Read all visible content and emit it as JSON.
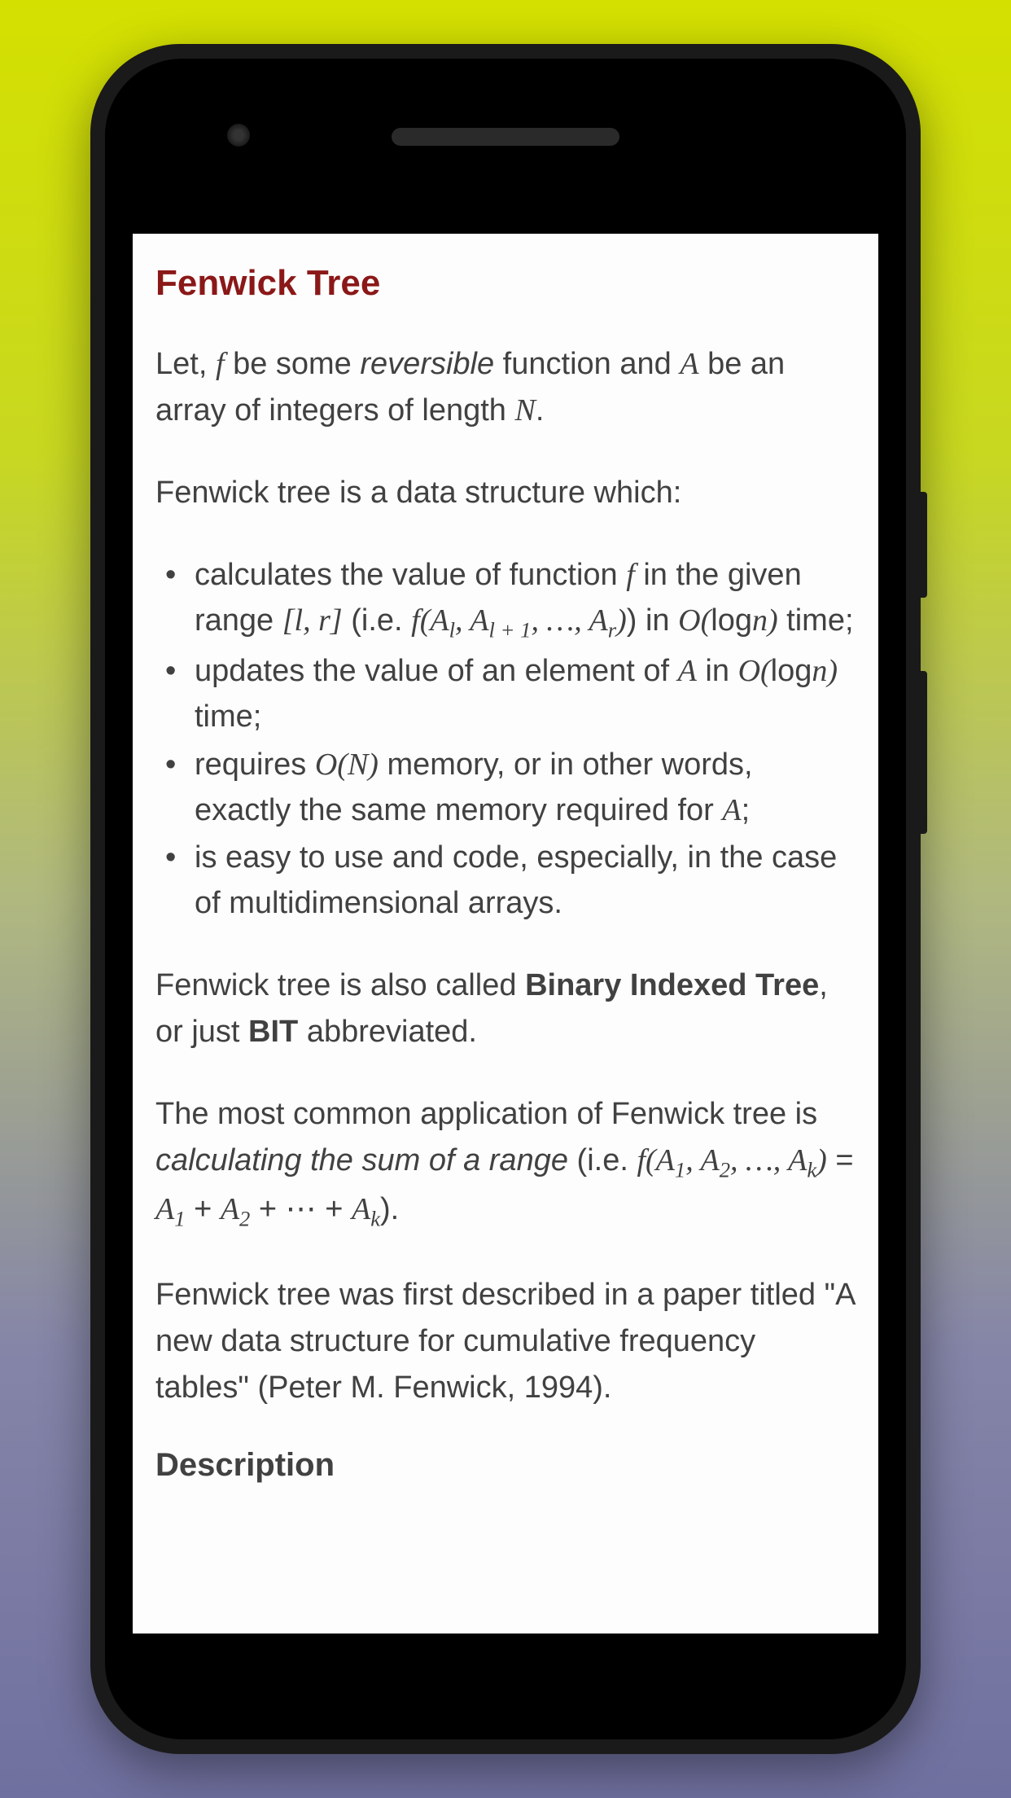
{
  "article": {
    "title": "Fenwick Tree",
    "intro_p1": "Let, ",
    "intro_f": "f",
    "intro_p2": " be some ",
    "intro_rev": "reversible",
    "intro_p3": " function and ",
    "intro_A": "A",
    "intro_p4": " be an array of integers of length ",
    "intro_N": "N",
    "intro_p5": ".",
    "p2": "Fenwick tree is a data structure which:",
    "bullets": {
      "b1_a": "calculates the value of function ",
      "b1_f": "f",
      "b1_b": " in the given range ",
      "b1_range": "[l, r]",
      "b1_c": " (i.e. ",
      "b1_func": "f(A",
      "b1_sub1": "l",
      "b1_comma1": ", A",
      "b1_sub2": "l + 1",
      "b1_comma2": ", …, A",
      "b1_sub3": "r",
      "b1_close": ")",
      "b1_d": ") in ",
      "b1_O": "O(",
      "b1_log": "log",
      "b1_n": "n",
      "b1_Oclose": ")",
      "b1_e": " time;",
      "b2_a": "updates the value of an element of ",
      "b2_A": "A",
      "b2_b": " in ",
      "b2_O": "O(",
      "b2_log": "log",
      "b2_n": "n",
      "b2_Oclose": ")",
      "b2_c": " time;",
      "b3_a": "requires ",
      "b3_O": "O(N)",
      "b3_b": " memory, or in other words, exactly the same memory required for ",
      "b3_A": "A",
      "b3_c": ";",
      "b4": "is easy to use and code, especially, in the case of multidimensional arrays."
    },
    "p3_a": "Fenwick tree is also called ",
    "p3_bit": "Binary Indexed Tree",
    "p3_b": ", or just ",
    "p3_bit2": "BIT",
    "p3_c": " abbreviated.",
    "p4_a": "The most common application of Fenwick tree is ",
    "p4_it": "calculating the sum of a range",
    "p4_b": " (i.e. ",
    "p4_f": "f(A",
    "p4_s1": "1",
    "p4_c1": ", A",
    "p4_s2": "2",
    "p4_c2": ", …, A",
    "p4_sk": "k",
    "p4_close": ")",
    "p4_eq": " = ",
    "p4_A1": "A",
    "p4_s1b": "1",
    "p4_plus1": " + ",
    "p4_A2": "A",
    "p4_s2b": "2",
    "p4_plus2": " + ⋯ + ",
    "p4_Ak": "A",
    "p4_skb": "k",
    "p4_end": ").",
    "p5": "Fenwick tree was first described in a paper titled \"A new data structure for cumulative frequency tables\" (Peter M. Fenwick, 1994).",
    "section_desc": "Description"
  }
}
